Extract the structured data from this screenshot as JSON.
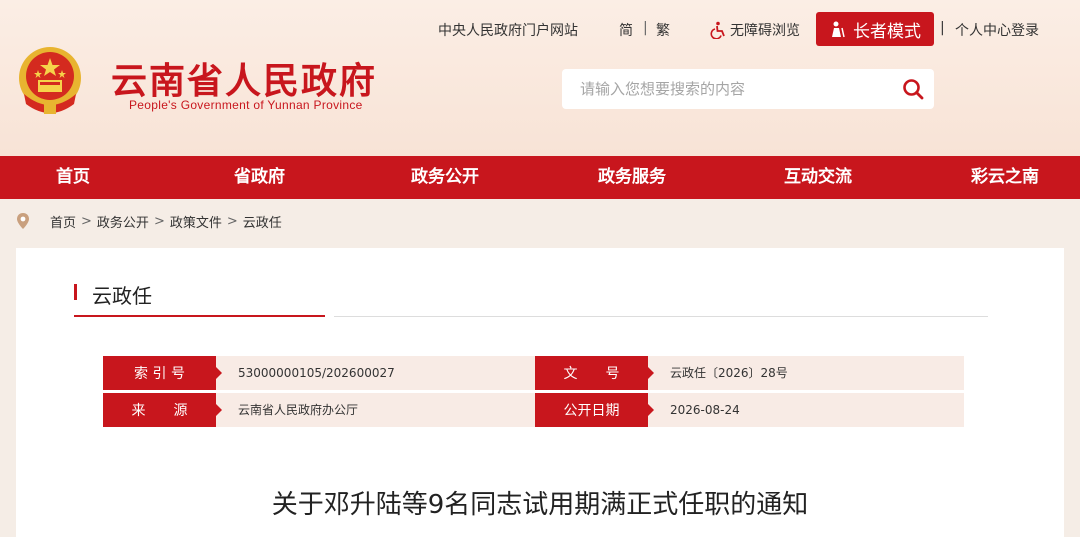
{
  "header": {
    "title": "云南省人民政府",
    "subtitle": "People's Government of Yunnan Province",
    "top_links": {
      "portal": "中央人民政府门户网站",
      "simplified": "简",
      "separator": "|",
      "traditional": "繁",
      "accessibility": "无障碍浏览",
      "elder_mode": "长者模式",
      "login": "个人中心登录"
    },
    "search": {
      "placeholder": "请输入您想要搜索的内容"
    }
  },
  "nav": {
    "items": [
      "首页",
      "省政府",
      "政务公开",
      "政务服务",
      "互动交流",
      "彩云之南"
    ]
  },
  "breadcrumb": [
    "首页",
    "政务公开",
    "政策文件",
    "云政任"
  ],
  "breadcrumb_sep": ">",
  "section": {
    "title": "云政任"
  },
  "info": {
    "index_label": "索 引 号",
    "index_value": "53000000105/202600027",
    "docno_label": "文　　号",
    "docno_value": "云政任〔2026〕28号",
    "source_label": "来　　源",
    "source_value": "云南省人民政府办公厅",
    "date_label": "公开日期",
    "date_value": "2026-08-24"
  },
  "document": {
    "title": "关于邓升陆等9名同志试用期满正式任职的通知"
  },
  "colors": {
    "brand_red": "#c8161d",
    "header_bg": "#fbeee5",
    "info_bg": "#f8ebe5"
  }
}
